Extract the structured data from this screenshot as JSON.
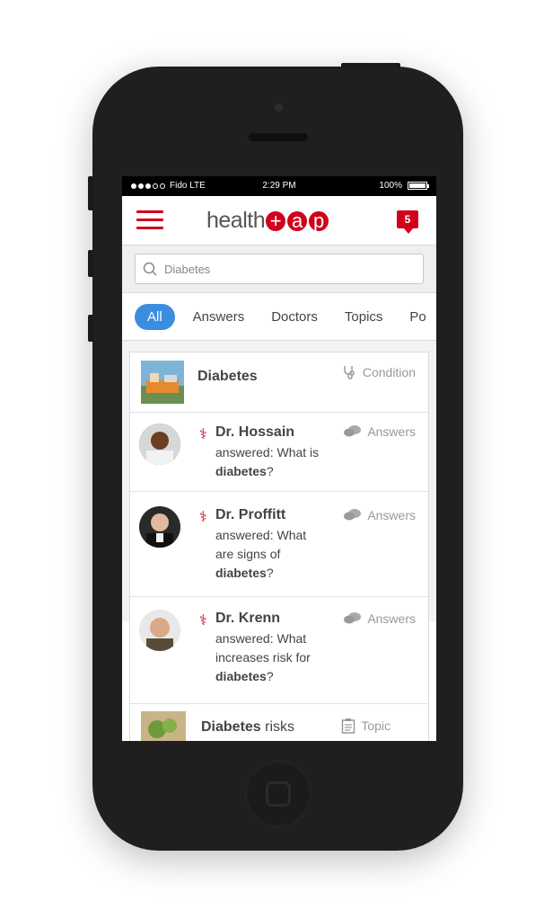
{
  "status_bar": {
    "carrier": "Fido LTE",
    "time": "2:29 PM",
    "battery": "100%"
  },
  "header": {
    "logo_text": "health",
    "logo_tap": [
      "+",
      "a",
      "p"
    ],
    "notification_count": "5"
  },
  "search": {
    "value": "Diabetes"
  },
  "tabs": [
    "All",
    "Answers",
    "Doctors",
    "Topics",
    "Po"
  ],
  "results": {
    "condition": {
      "title": "Diabetes",
      "type": "Condition",
      "type_icon": "stethoscope-icon"
    },
    "answers": [
      {
        "name": "Dr. Hossain",
        "text_pre": "answered: What is ",
        "text_bold": "diabetes",
        "text_post": "?",
        "type": "Answers"
      },
      {
        "name": "Dr. Proffitt",
        "text_pre": "answered: What are signs of ",
        "text_bold": "diabetes",
        "text_post": "?",
        "type": "Answers"
      },
      {
        "name": "Dr. Krenn",
        "text_pre": "answered: What increases risk for ",
        "text_bold": "diabetes",
        "text_post": "?",
        "type": "Answers"
      }
    ],
    "topic": {
      "title_bold": "Diabetes",
      "title_rest": " risks",
      "type": "Topic"
    }
  },
  "colors": {
    "brand_red": "#d0021b",
    "active_tab": "#3b8de0"
  }
}
